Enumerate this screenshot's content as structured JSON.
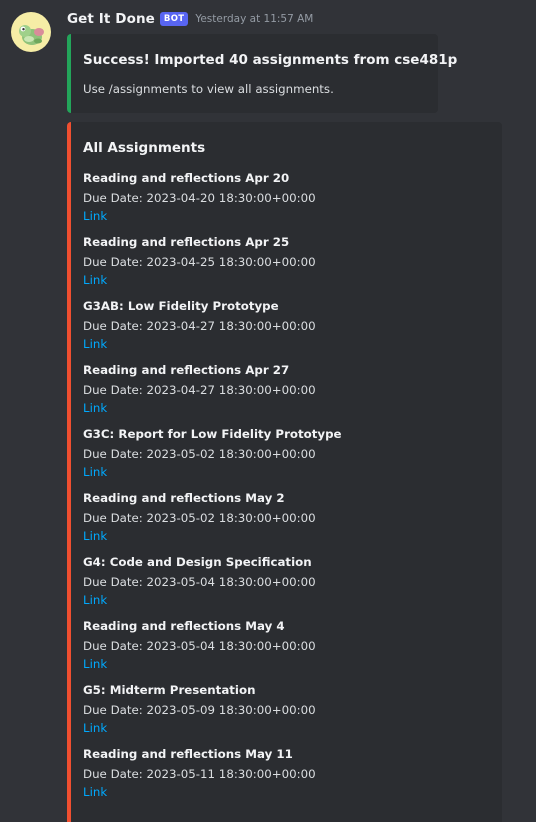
{
  "message": {
    "username": "Get It Done",
    "bot_tag": "BOT",
    "timestamp": "Yesterday at 11:57 AM"
  },
  "success_embed": {
    "title": "Success! Imported 40 assignments from cse481p",
    "description": "Use /assignments to view all assignments.",
    "accent_color": "#23a55a"
  },
  "assignments_embed": {
    "title": "All Assignments",
    "accent_color": "#f04f30",
    "due_prefix": "Due Date: ",
    "link_label": "Link",
    "items": [
      {
        "name": "Reading and reflections Apr 20",
        "due": "2023-04-20 18:30:00+00:00"
      },
      {
        "name": "Reading and reflections Apr 25",
        "due": "2023-04-25 18:30:00+00:00"
      },
      {
        "name": "G3AB: Low Fidelity Prototype",
        "due": "2023-04-27 18:30:00+00:00"
      },
      {
        "name": "Reading and reflections Apr 27",
        "due": "2023-04-27 18:30:00+00:00"
      },
      {
        "name": "G3C: Report for Low Fidelity Prototype",
        "due": "2023-05-02 18:30:00+00:00"
      },
      {
        "name": "Reading and reflections May 2",
        "due": "2023-05-02 18:30:00+00:00"
      },
      {
        "name": "G4: Code and Design Specification",
        "due": "2023-05-04 18:30:00+00:00"
      },
      {
        "name": "Reading and reflections May 4",
        "due": "2023-05-04 18:30:00+00:00"
      },
      {
        "name": "G5: Midterm Presentation",
        "due": "2023-05-09 18:30:00+00:00"
      },
      {
        "name": "Reading and reflections May 11",
        "due": "2023-05-11 18:30:00+00:00"
      }
    ]
  },
  "colors": {
    "background": "#313338",
    "embed_background": "#2b2d31",
    "link": "#00a8fc",
    "bot_tag": "#5865f2"
  }
}
